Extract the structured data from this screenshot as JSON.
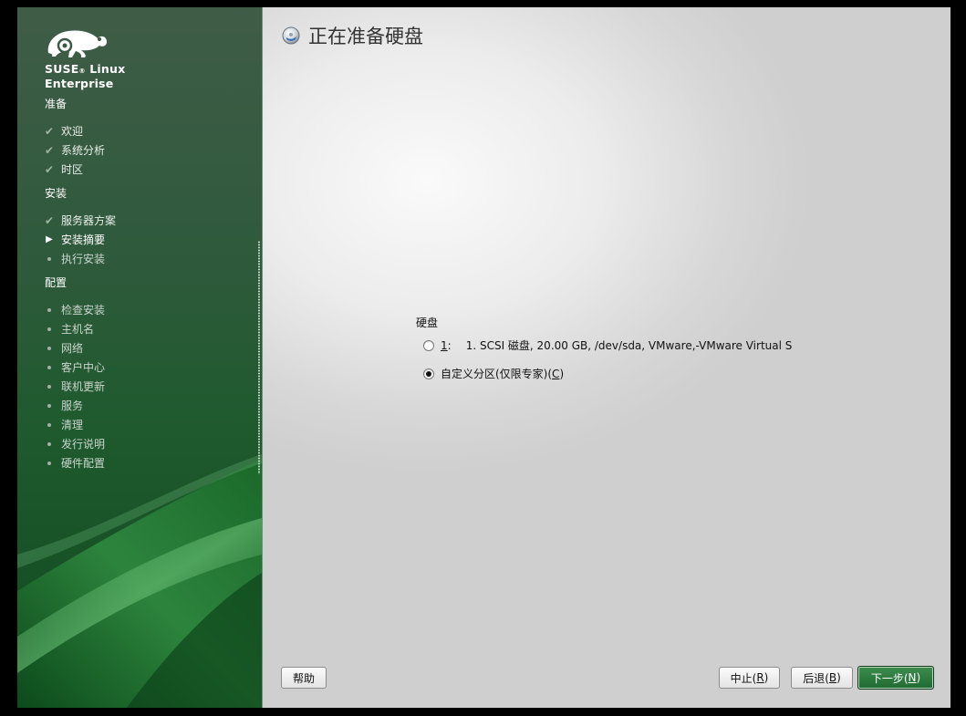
{
  "brand": {
    "line1": "SUSE",
    "reg": "®",
    "line1b": " Linux",
    "line2": "Enterprise"
  },
  "sidebar": {
    "sections": [
      {
        "label": "准备",
        "items": [
          {
            "label": "欢迎",
            "state": "done"
          },
          {
            "label": "系统分析",
            "state": "done"
          },
          {
            "label": "时区",
            "state": "done"
          }
        ]
      },
      {
        "label": "安装",
        "items": [
          {
            "label": "服务器方案",
            "state": "done"
          },
          {
            "label": "安装摘要",
            "state": "current"
          },
          {
            "label": "执行安装",
            "state": "todo"
          }
        ]
      },
      {
        "label": "配置",
        "items": [
          {
            "label": "检查安装",
            "state": "todo"
          },
          {
            "label": "主机名",
            "state": "todo"
          },
          {
            "label": "网络",
            "state": "todo"
          },
          {
            "label": "客户中心",
            "state": "todo"
          },
          {
            "label": "联机更新",
            "state": "todo"
          },
          {
            "label": "服务",
            "state": "todo"
          },
          {
            "label": "清理",
            "state": "todo"
          },
          {
            "label": "发行说明",
            "state": "todo"
          },
          {
            "label": "硬件配置",
            "state": "todo"
          }
        ]
      }
    ]
  },
  "main": {
    "title": "正在准备硬盘",
    "disk_group_label": "硬盘",
    "options": [
      {
        "key": "1",
        "sep": ":",
        "text": "1. SCSI 磁盘, 20.00 GB, /dev/sda, VMware,-VMware Virtual S",
        "checked": false
      },
      {
        "prefix": "自定义分区(仅限专家)(",
        "key": "C",
        "suffix": ")",
        "checked": true
      }
    ]
  },
  "buttons": {
    "help": "帮助",
    "abort": {
      "prefix": "中止(",
      "key": "R",
      "suffix": ")"
    },
    "back": {
      "prefix": "后退(",
      "key": "B",
      "suffix": ")"
    },
    "next": {
      "prefix": "下一步(",
      "key": "N",
      "suffix": ")"
    }
  },
  "colors": {
    "sidebar_green": "#1f5a2e",
    "primary_button": "#2a7a3c"
  }
}
